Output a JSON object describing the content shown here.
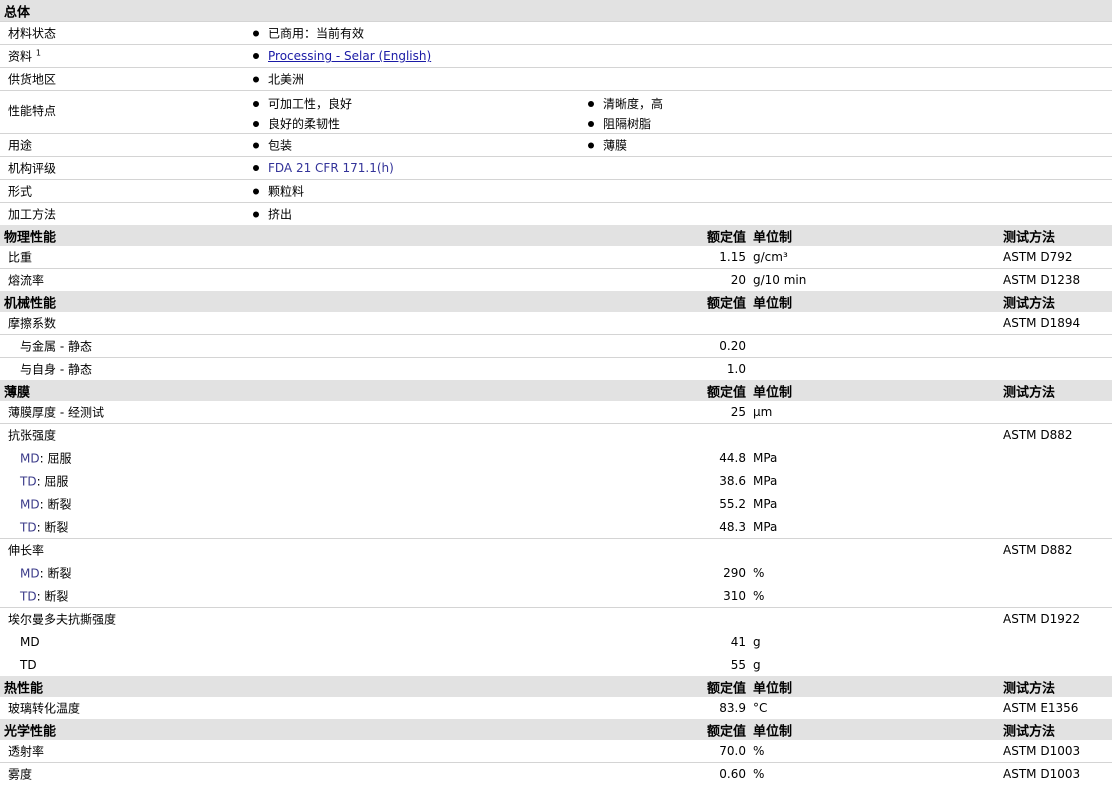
{
  "general": {
    "title": "总体",
    "rows": [
      {
        "label": "材料状态",
        "items": [
          "已商用：当前有效"
        ]
      },
      {
        "label": "资料",
        "sup": "1",
        "link": "Processing - Selar (English)"
      },
      {
        "label": "供货地区",
        "items": [
          "北美洲"
        ]
      },
      {
        "label": "性能特点",
        "col1": [
          "可加工性，良好",
          "良好的柔韧性"
        ],
        "col2": [
          "清晰度，高",
          "阻隔树脂"
        ]
      },
      {
        "label": "用途",
        "col1": [
          "包装"
        ],
        "col2": [
          "薄膜"
        ]
      },
      {
        "label": "机构评级",
        "items": [
          "FDA 21 CFR 171.1(h)"
        ]
      },
      {
        "label": "形式",
        "items": [
          "颗粒料"
        ]
      },
      {
        "label": "加工方法",
        "items": [
          "挤出"
        ]
      }
    ]
  },
  "column_headers": {
    "value": "额定值",
    "unit": "单位制",
    "test": "测试方法"
  },
  "physical": {
    "title": "物理性能",
    "rows": [
      {
        "label": "比重",
        "value": "1.15",
        "unit": "g/cm³",
        "test": "ASTM D792"
      },
      {
        "label": "熔流率",
        "value": "20",
        "unit": "g/10 min",
        "test": "ASTM D1238"
      }
    ]
  },
  "mechanical": {
    "title": "机械性能",
    "rows": [
      {
        "label": "摩擦系数",
        "value": "",
        "unit": "",
        "test": "ASTM D1894"
      },
      {
        "label": "与金属 - 静态",
        "value": "0.20",
        "unit": "",
        "test": ""
      },
      {
        "label": "与自身 - 静态",
        "value": "1.0",
        "unit": "",
        "test": ""
      }
    ]
  },
  "film": {
    "title": "薄膜",
    "rows": [
      {
        "label": "薄膜厚度 - 经测试",
        "value": "25",
        "unit": "µm",
        "test": ""
      },
      {
        "label": "抗张强度",
        "value": "",
        "unit": "",
        "test": "ASTM D882"
      },
      {
        "prefix": "MD",
        "label": ": 屈服",
        "value": "44.8",
        "unit": "MPa",
        "test": ""
      },
      {
        "prefix": "TD",
        "label": ": 屈服",
        "value": "38.6",
        "unit": "MPa",
        "test": ""
      },
      {
        "prefix": "MD",
        "label": ": 断裂",
        "value": "55.2",
        "unit": "MPa",
        "test": ""
      },
      {
        "prefix": "TD",
        "label": ": 断裂",
        "value": "48.3",
        "unit": "MPa",
        "test": ""
      },
      {
        "label": "伸长率",
        "value": "",
        "unit": "",
        "test": "ASTM D882"
      },
      {
        "prefix": "MD",
        "label": ": 断裂",
        "value": "290",
        "unit": "%",
        "test": ""
      },
      {
        "prefix": "TD",
        "label": ": 断裂",
        "value": "310",
        "unit": "%",
        "test": ""
      },
      {
        "label": "埃尔曼多夫抗撕强度",
        "value": "",
        "unit": "",
        "test": "ASTM D1922"
      },
      {
        "prefix": "MD",
        "label": "",
        "value": "41",
        "unit": "g",
        "test": ""
      },
      {
        "prefix": "TD",
        "label": "",
        "value": "55",
        "unit": "g",
        "test": ""
      }
    ]
  },
  "thermal": {
    "title": "热性能",
    "rows": [
      {
        "label": "玻璃转化温度",
        "value": "83.9",
        "unit": "°C",
        "test": "ASTM E1356"
      }
    ]
  },
  "optical": {
    "title": "光学性能",
    "rows": [
      {
        "label": "透射率",
        "value": "70.0",
        "unit": "%",
        "test": "ASTM D1003"
      },
      {
        "label": "雾度",
        "value": "0.60",
        "unit": "%",
        "test": "ASTM D1003"
      }
    ]
  }
}
